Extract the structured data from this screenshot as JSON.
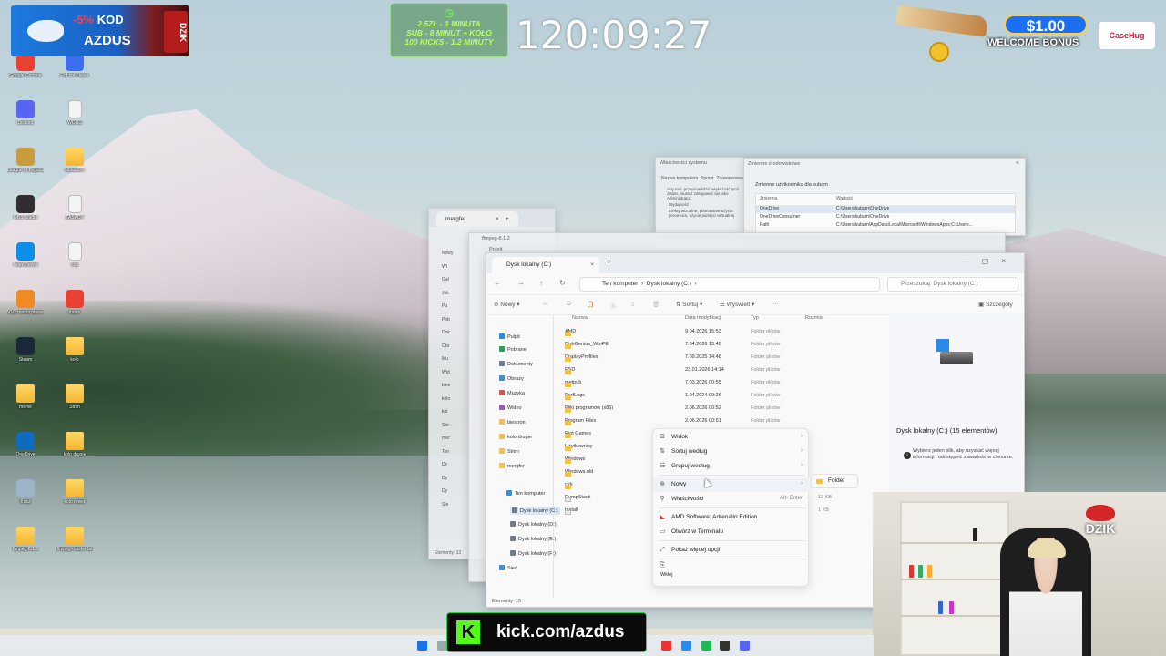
{
  "desktop": {
    "icons": [
      {
        "label": "Google Chrome",
        "color": "#e94235"
      },
      {
        "label": "Roblox Player",
        "color": "#3b6ff0"
      },
      {
        "label": "Discord",
        "color": "#5865f2"
      },
      {
        "label": "WORD",
        "color": "file"
      },
      {
        "label": "League of Legends",
        "color": "#c89b3c"
      },
      {
        "label": "kibadown",
        "color": "folder"
      },
      {
        "label": "OBS Studio",
        "color": "#302e31"
      },
      {
        "label": "ZASADY",
        "color": "file"
      },
      {
        "label": "TeamViewer",
        "color": "#0e8ee9"
      },
      {
        "label": "cos",
        "color": "file"
      },
      {
        "label": "VLC media player",
        "color": "#f08a24"
      },
      {
        "label": "index",
        "color": "#e94235"
      },
      {
        "label": "Steam",
        "color": "#1b2838"
      },
      {
        "label": "kolo",
        "color": "folder"
      },
      {
        "label": "meme",
        "color": "folder"
      },
      {
        "label": "Strim",
        "color": "folder"
      },
      {
        "label": "OneDrive",
        "color": "#0f6cbd"
      },
      {
        "label": "kolo drugie",
        "color": "folder"
      },
      {
        "label": "Kosz",
        "color": "#9fb3c8"
      },
      {
        "label": "kolo rower",
        "color": "folder"
      },
      {
        "label": "ffmpeg-8.1.2",
        "color": "folder"
      },
      {
        "label": "ffmpeg-master-lat",
        "color": "folder"
      }
    ]
  },
  "promo": {
    "percent": "-5%",
    "kod": "KOD",
    "code": "AZDUS",
    "brand": "DZIK"
  },
  "timer_box": {
    "line1": "2.5ZŁ - 1 MINUTA",
    "line2": "SUB - 8 MINUT + KOŁO",
    "line3": "100 KICKS - 1.2 MINUTY"
  },
  "big_timer": "120:09:27",
  "bonus": {
    "amount": "$1.00",
    "label": "WELCOME BONUS",
    "site": "CaseHug"
  },
  "bg_windows": {
    "w1_tab": "mergfer",
    "w2_tab": "ffmpeg-8.1.2",
    "w3_tab": "Pobrit",
    "sysprop_title": "Właściwości systemu",
    "sysprop_tabs": [
      "Nazwa komputera",
      "Sprzęt",
      "Zaawansowane"
    ],
    "sysprop_text1": "Aby móc przeprowadzić większość tych zmian, musisz zalogować się jako Administrator.",
    "sysprop_text2": "Wydajność",
    "sysprop_text3": "Efekty wizualne, planowanie użycia procesora, użycie pamięci wirtualnej",
    "envvar_title": "Zmienne środowiskowe",
    "envvar_section": "Zmienne użytkownika dla kubam",
    "envvar_col1": "Zmienna",
    "envvar_col2": "Wartość",
    "envvars": [
      {
        "name": "OneDrive",
        "value": "C:\\Users\\kubam\\OneDrive"
      },
      {
        "name": "OneDriveConsumer",
        "value": "C:\\Users\\kubam\\OneDrive"
      },
      {
        "name": "Path",
        "value": "C:\\Users\\kubam\\AppData\\Local\\Microsoft\\WindowsApps;C:\\Users..."
      }
    ],
    "left_nav": [
      "Nowy",
      "Wi",
      "Gal",
      "Jok",
      "Pu",
      "Pob",
      "Dok",
      "Obr",
      "Mu",
      "Wid",
      "bies",
      "kolo",
      "kol",
      "Stri",
      "mer",
      "Ten",
      "Dy",
      "Dy",
      "Dy",
      "Sie"
    ],
    "left_status": "Elementy: 13"
  },
  "explorer": {
    "tab_title": "Dysk lokalny (C:)",
    "breadcrumb": [
      "Ten komputer",
      "Dysk lokalny (C:)"
    ],
    "search_placeholder": "Przeszukaj: Dysk lokalny (C:)",
    "cmd": {
      "new": "Nowy",
      "sort": "Sortuj",
      "view": "Wyświetl",
      "more": "···",
      "details": "Szczegóły"
    },
    "columns": {
      "name": "Nazwa",
      "date": "Data modyfikacji",
      "type": "Typ",
      "size": "Rozmiar"
    },
    "sidebar": [
      {
        "label": "Pulpit",
        "color": "#2b8be8"
      },
      {
        "label": "Pobrane",
        "color": "#2c9e5a"
      },
      {
        "label": "Dokumenty",
        "color": "#6d7d8f"
      },
      {
        "label": "Obrazy",
        "color": "#3e8ed0"
      },
      {
        "label": "Muzyka",
        "color": "#d9534f"
      },
      {
        "label": "Wideo",
        "color": "#9b59b6"
      },
      {
        "label": "biestron",
        "color": "#f2c14d"
      },
      {
        "label": "kolo drugie",
        "color": "#f2c14d"
      },
      {
        "label": "Strim",
        "color": "#f2c14d"
      },
      {
        "label": "mergfer",
        "color": "#f2c14d"
      },
      {
        "label": "Ten komputer",
        "color": "#3b8fd6"
      },
      {
        "label": "Dysk lokalny (C:)",
        "color": "#6d7d8f"
      },
      {
        "label": "Dysk lokalny (D:)",
        "color": "#6d7d8f"
      },
      {
        "label": "Dysk lokalny (E:)",
        "color": "#6d7d8f"
      },
      {
        "label": "Dysk lokalny (F:)",
        "color": "#6d7d8f"
      },
      {
        "label": "Sieć",
        "color": "#3b8fd6"
      }
    ],
    "files": [
      {
        "name": "AMD",
        "date": "9.04.2026 15:53",
        "type": "Folder plików",
        "size": ""
      },
      {
        "name": "DiskGenius_WinPE",
        "date": "7.04.2026 13:49",
        "type": "Folder plików",
        "size": ""
      },
      {
        "name": "DisplayProfiles",
        "date": "7.09.2025 14:48",
        "type": "Folder plików",
        "size": ""
      },
      {
        "name": "ESD",
        "date": "23.01.2026 14:14",
        "type": "Folder plików",
        "size": ""
      },
      {
        "name": "metpub",
        "date": "7.03.2026 00:55",
        "type": "Folder plików",
        "size": ""
      },
      {
        "name": "PerfLogs",
        "date": "1.04.2024 09:26",
        "type": "Folder plików",
        "size": ""
      },
      {
        "name": "Pliki programów (x86)",
        "date": "2.06.2026 00:52",
        "type": "Folder plików",
        "size": ""
      },
      {
        "name": "Program Files",
        "date": "2.06.2026 00:51",
        "type": "Folder plików",
        "size": ""
      },
      {
        "name": "Riot Games",
        "date": "",
        "type": "",
        "size": ""
      },
      {
        "name": "Użytkownicy",
        "date": "",
        "type": "",
        "size": ""
      },
      {
        "name": "Windows",
        "date": "",
        "type": "",
        "size": ""
      },
      {
        "name": "Windows.old",
        "date": "",
        "type": "",
        "size": ""
      },
      {
        "name": "csb",
        "date": "",
        "type": "",
        "size": ""
      },
      {
        "name": "DumpStack",
        "date": "",
        "type": "",
        "size": "12 KB"
      },
      {
        "name": "Install",
        "date": "",
        "type": "",
        "size": "1 KB"
      }
    ],
    "details_title": "Dysk lokalny (C:) (15 elementów)",
    "details_info": "Wybierz jeden plik, aby uzyskać więcej informacji i udostępnić zawartość w chmurze.",
    "status": "Elementy: 15"
  },
  "context_menu": {
    "items": [
      {
        "label": "Widok",
        "icon": "grid-icon",
        "arrow": "›"
      },
      {
        "label": "Sortuj według",
        "icon": "sort-icon",
        "arrow": "›"
      },
      {
        "label": "Grupuj według",
        "icon": "group-icon",
        "arrow": "›"
      },
      {
        "label": "Nowy",
        "icon": "new-icon",
        "arrow": "›"
      },
      {
        "label": "Właściwości",
        "icon": "wrench-icon",
        "shortcut": "Alt+Enter"
      },
      {
        "label": "AMD Software: Adrenalin Edition",
        "icon": "amd-icon"
      },
      {
        "label": "Otwórz w Terminalu",
        "icon": "terminal-icon"
      },
      {
        "label": "Pokaż więcej opcji",
        "icon": "more-icon"
      },
      {
        "label": "Wklej",
        "icon": "paste-icon"
      }
    ],
    "submenu": "Folder"
  },
  "webcam": {
    "logo": "DZIK"
  },
  "kick": {
    "letter": "K",
    "url": "kick.com/azdus"
  }
}
